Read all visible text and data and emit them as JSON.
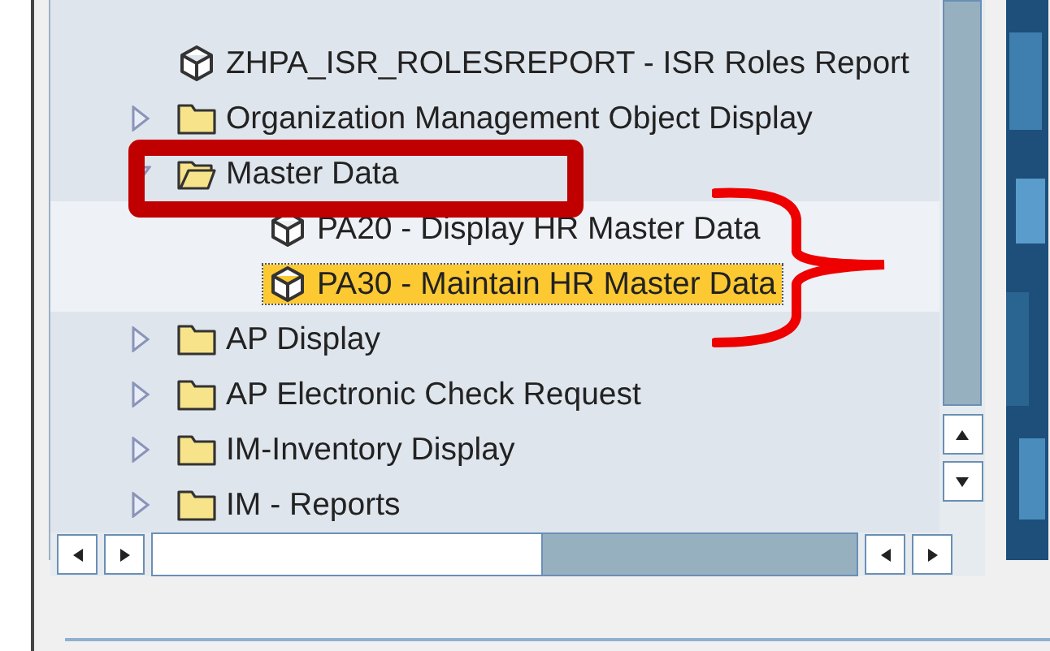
{
  "tree": [
    {
      "kind": "transaction",
      "label": "ZHPA_ISR_ROLESREPORT - ISR Roles Report",
      "selected": false
    },
    {
      "kind": "folder",
      "label": "Organization Management Object Display",
      "expanded": false,
      "selected": false
    },
    {
      "kind": "folder",
      "label": "Master Data",
      "expanded": true,
      "selected": false,
      "children": [
        {
          "kind": "transaction",
          "label": "PA20 - Display HR Master Data",
          "selected": false
        },
        {
          "kind": "transaction",
          "label": "PA30 - Maintain HR Master Data",
          "selected": true
        }
      ]
    },
    {
      "kind": "folder",
      "label": "AP Display",
      "expanded": false,
      "selected": false
    },
    {
      "kind": "folder",
      "label": "AP Electronic Check Request",
      "expanded": false,
      "selected": false
    },
    {
      "kind": "folder",
      "label": "IM-Inventory Display",
      "expanded": false,
      "selected": false
    },
    {
      "kind": "folder",
      "label": "IM - Reports",
      "expanded": false,
      "selected": false
    }
  ]
}
